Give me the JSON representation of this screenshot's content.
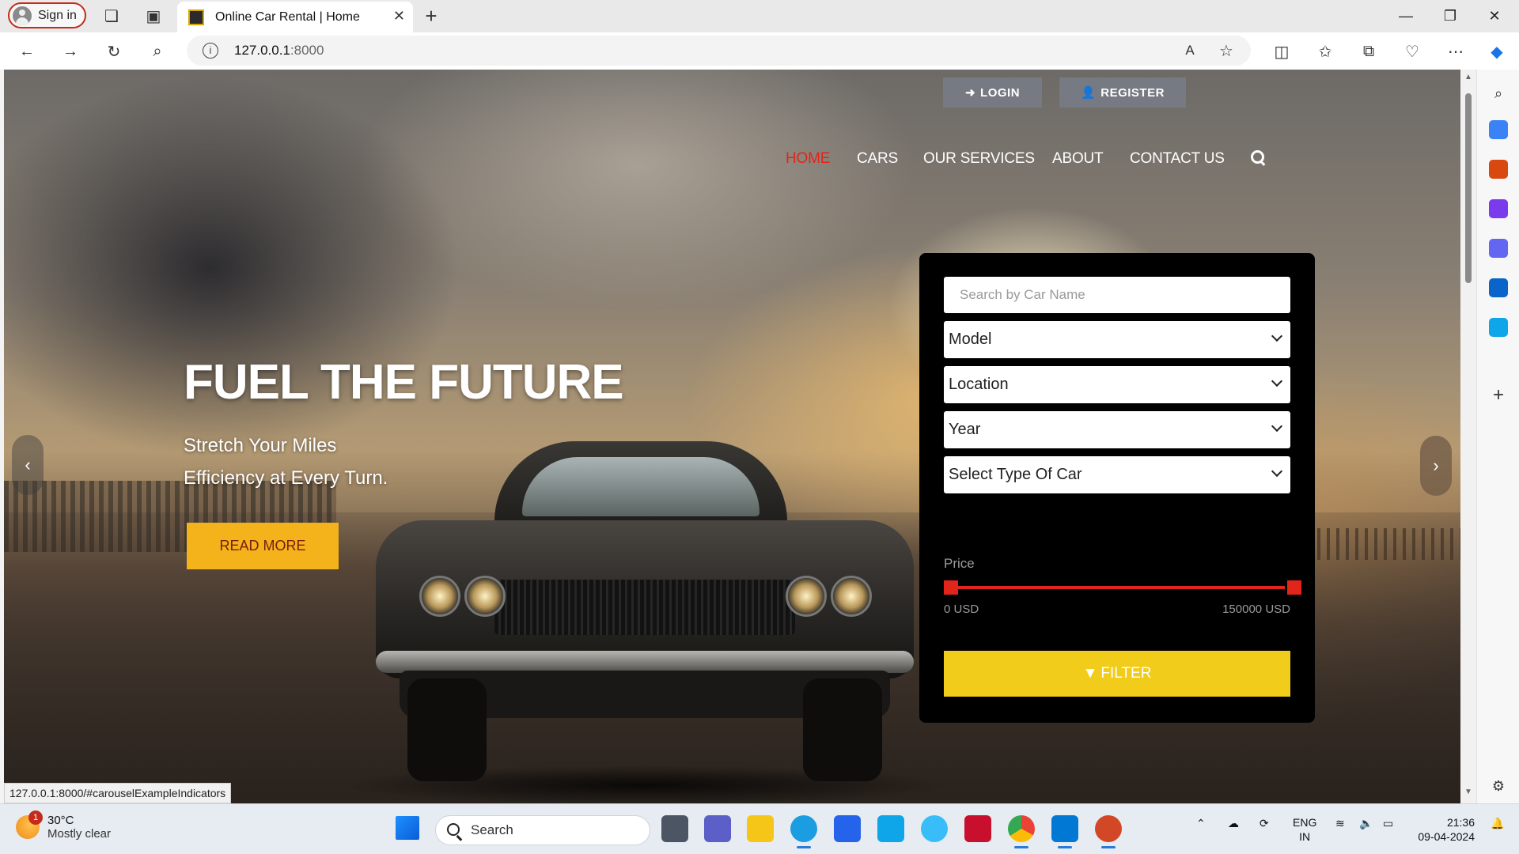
{
  "browser": {
    "signin_label": "Sign in",
    "tab_title": "Online Car Rental | Home",
    "url_host": "127.0.0.1",
    "url_port": ":8000",
    "status_url": "127.0.0.1:8000/#carouselExampleIndicators"
  },
  "site": {
    "top_buttons": {
      "login": "LOGIN",
      "register": "REGISTER"
    },
    "nav": [
      "HOME",
      "CARS",
      "OUR SERVICES",
      "ABOUT",
      "CONTACT US"
    ],
    "active_nav": "HOME",
    "accent_color": "#e1251b"
  },
  "hero": {
    "title": "FUEL THE FUTURE",
    "subtitle_line1": "Stretch Your Miles",
    "subtitle_line2": "Efficiency at Every Turn.",
    "cta": "READ MORE",
    "cta_color": "#f4b21b",
    "prev_icon": "chevron-left",
    "next_icon": "chevron-right"
  },
  "filter": {
    "search_placeholder": "Search by Car Name",
    "model": "Model",
    "location": "Location",
    "year": "Year",
    "car_type": "Select Type Of Car",
    "price_label": "Price",
    "price_min": "0 USD",
    "price_max": "150000 USD",
    "price_range_selected": [
      0,
      150000
    ],
    "button": "FILTER",
    "button_color": "#f2cc1a"
  },
  "taskbar": {
    "weather_temp": "30°C",
    "weather_desc": "Mostly clear",
    "weather_badge": "1",
    "search_label": "Search",
    "lang_line1": "ENG",
    "lang_line2": "IN",
    "time": "21:36",
    "date": "09-04-2024"
  }
}
